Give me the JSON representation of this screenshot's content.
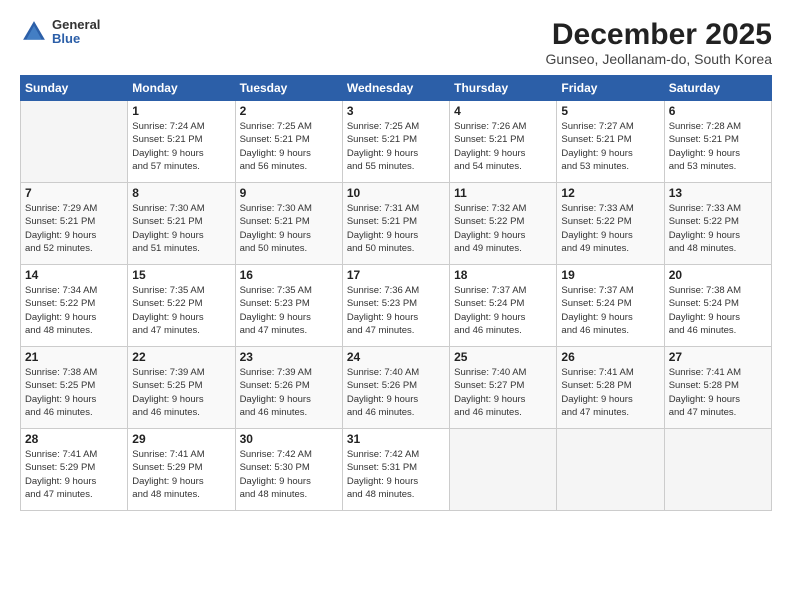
{
  "logo": {
    "general": "General",
    "blue": "Blue"
  },
  "title": "December 2025",
  "subtitle": "Gunseo, Jeollanam-do, South Korea",
  "days_header": [
    "Sunday",
    "Monday",
    "Tuesday",
    "Wednesday",
    "Thursday",
    "Friday",
    "Saturday"
  ],
  "weeks": [
    [
      {
        "day": "",
        "info": ""
      },
      {
        "day": "1",
        "info": "Sunrise: 7:24 AM\nSunset: 5:21 PM\nDaylight: 9 hours\nand 57 minutes."
      },
      {
        "day": "2",
        "info": "Sunrise: 7:25 AM\nSunset: 5:21 PM\nDaylight: 9 hours\nand 56 minutes."
      },
      {
        "day": "3",
        "info": "Sunrise: 7:25 AM\nSunset: 5:21 PM\nDaylight: 9 hours\nand 55 minutes."
      },
      {
        "day": "4",
        "info": "Sunrise: 7:26 AM\nSunset: 5:21 PM\nDaylight: 9 hours\nand 54 minutes."
      },
      {
        "day": "5",
        "info": "Sunrise: 7:27 AM\nSunset: 5:21 PM\nDaylight: 9 hours\nand 53 minutes."
      },
      {
        "day": "6",
        "info": "Sunrise: 7:28 AM\nSunset: 5:21 PM\nDaylight: 9 hours\nand 53 minutes."
      }
    ],
    [
      {
        "day": "7",
        "info": "Sunrise: 7:29 AM\nSunset: 5:21 PM\nDaylight: 9 hours\nand 52 minutes."
      },
      {
        "day": "8",
        "info": "Sunrise: 7:30 AM\nSunset: 5:21 PM\nDaylight: 9 hours\nand 51 minutes."
      },
      {
        "day": "9",
        "info": "Sunrise: 7:30 AM\nSunset: 5:21 PM\nDaylight: 9 hours\nand 50 minutes."
      },
      {
        "day": "10",
        "info": "Sunrise: 7:31 AM\nSunset: 5:21 PM\nDaylight: 9 hours\nand 50 minutes."
      },
      {
        "day": "11",
        "info": "Sunrise: 7:32 AM\nSunset: 5:22 PM\nDaylight: 9 hours\nand 49 minutes."
      },
      {
        "day": "12",
        "info": "Sunrise: 7:33 AM\nSunset: 5:22 PM\nDaylight: 9 hours\nand 49 minutes."
      },
      {
        "day": "13",
        "info": "Sunrise: 7:33 AM\nSunset: 5:22 PM\nDaylight: 9 hours\nand 48 minutes."
      }
    ],
    [
      {
        "day": "14",
        "info": "Sunrise: 7:34 AM\nSunset: 5:22 PM\nDaylight: 9 hours\nand 48 minutes."
      },
      {
        "day": "15",
        "info": "Sunrise: 7:35 AM\nSunset: 5:22 PM\nDaylight: 9 hours\nand 47 minutes."
      },
      {
        "day": "16",
        "info": "Sunrise: 7:35 AM\nSunset: 5:23 PM\nDaylight: 9 hours\nand 47 minutes."
      },
      {
        "day": "17",
        "info": "Sunrise: 7:36 AM\nSunset: 5:23 PM\nDaylight: 9 hours\nand 47 minutes."
      },
      {
        "day": "18",
        "info": "Sunrise: 7:37 AM\nSunset: 5:24 PM\nDaylight: 9 hours\nand 46 minutes."
      },
      {
        "day": "19",
        "info": "Sunrise: 7:37 AM\nSunset: 5:24 PM\nDaylight: 9 hours\nand 46 minutes."
      },
      {
        "day": "20",
        "info": "Sunrise: 7:38 AM\nSunset: 5:24 PM\nDaylight: 9 hours\nand 46 minutes."
      }
    ],
    [
      {
        "day": "21",
        "info": "Sunrise: 7:38 AM\nSunset: 5:25 PM\nDaylight: 9 hours\nand 46 minutes."
      },
      {
        "day": "22",
        "info": "Sunrise: 7:39 AM\nSunset: 5:25 PM\nDaylight: 9 hours\nand 46 minutes."
      },
      {
        "day": "23",
        "info": "Sunrise: 7:39 AM\nSunset: 5:26 PM\nDaylight: 9 hours\nand 46 minutes."
      },
      {
        "day": "24",
        "info": "Sunrise: 7:40 AM\nSunset: 5:26 PM\nDaylight: 9 hours\nand 46 minutes."
      },
      {
        "day": "25",
        "info": "Sunrise: 7:40 AM\nSunset: 5:27 PM\nDaylight: 9 hours\nand 46 minutes."
      },
      {
        "day": "26",
        "info": "Sunrise: 7:41 AM\nSunset: 5:28 PM\nDaylight: 9 hours\nand 47 minutes."
      },
      {
        "day": "27",
        "info": "Sunrise: 7:41 AM\nSunset: 5:28 PM\nDaylight: 9 hours\nand 47 minutes."
      }
    ],
    [
      {
        "day": "28",
        "info": "Sunrise: 7:41 AM\nSunset: 5:29 PM\nDaylight: 9 hours\nand 47 minutes."
      },
      {
        "day": "29",
        "info": "Sunrise: 7:41 AM\nSunset: 5:29 PM\nDaylight: 9 hours\nand 48 minutes."
      },
      {
        "day": "30",
        "info": "Sunrise: 7:42 AM\nSunset: 5:30 PM\nDaylight: 9 hours\nand 48 minutes."
      },
      {
        "day": "31",
        "info": "Sunrise: 7:42 AM\nSunset: 5:31 PM\nDaylight: 9 hours\nand 48 minutes."
      },
      {
        "day": "",
        "info": ""
      },
      {
        "day": "",
        "info": ""
      },
      {
        "day": "",
        "info": ""
      }
    ]
  ]
}
